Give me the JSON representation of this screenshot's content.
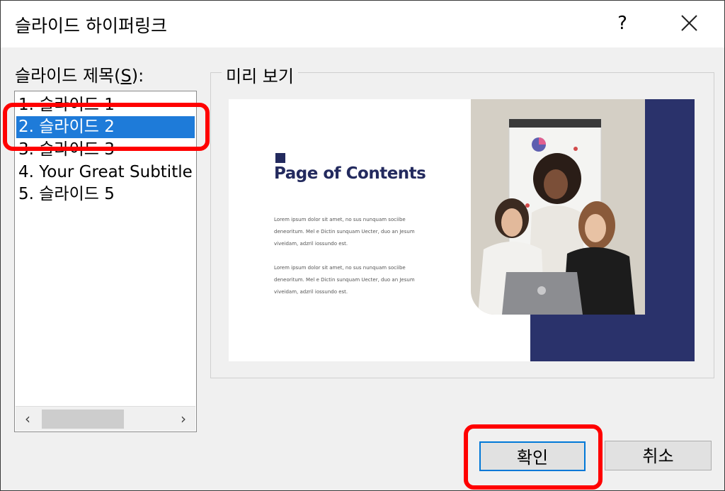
{
  "dialog": {
    "title": "슬라이드 하이퍼링크",
    "help_label": "?"
  },
  "slide_list": {
    "label_prefix": "슬라이드 제목(",
    "label_accel": "S",
    "label_suffix": "):",
    "items": [
      {
        "label": "1. 슬라이드 1"
      },
      {
        "label": "2. 슬라이드 2",
        "selected": true
      },
      {
        "label": "3. 슬라이드 3"
      },
      {
        "label": "4. Your Great Subtitle"
      },
      {
        "label": "5. 슬라이드 5"
      }
    ],
    "scroll_left": "‹",
    "scroll_right": "›"
  },
  "preview": {
    "label": "미리 보기",
    "slide_title": "Page of Contents",
    "paragraph_1": "Lorem ipsum dolor sit amet, no sus nunquam sociibe deneoritum. Mel e Dictin sunquam Uecter, duo an Jesum viveidam, adzril iossundo est.",
    "paragraph_2": "Lorem ipsum dolor sit amet, no sus nunquam sociibe deneoritum. Mel e Dictin sunquam Uecter, duo an Jesum viveidam, adzril iossundo est.",
    "accent_color": "#2a326b"
  },
  "buttons": {
    "ok": "확인",
    "cancel": "취소"
  },
  "annotations": {
    "highlight_color": "#ff0000"
  }
}
